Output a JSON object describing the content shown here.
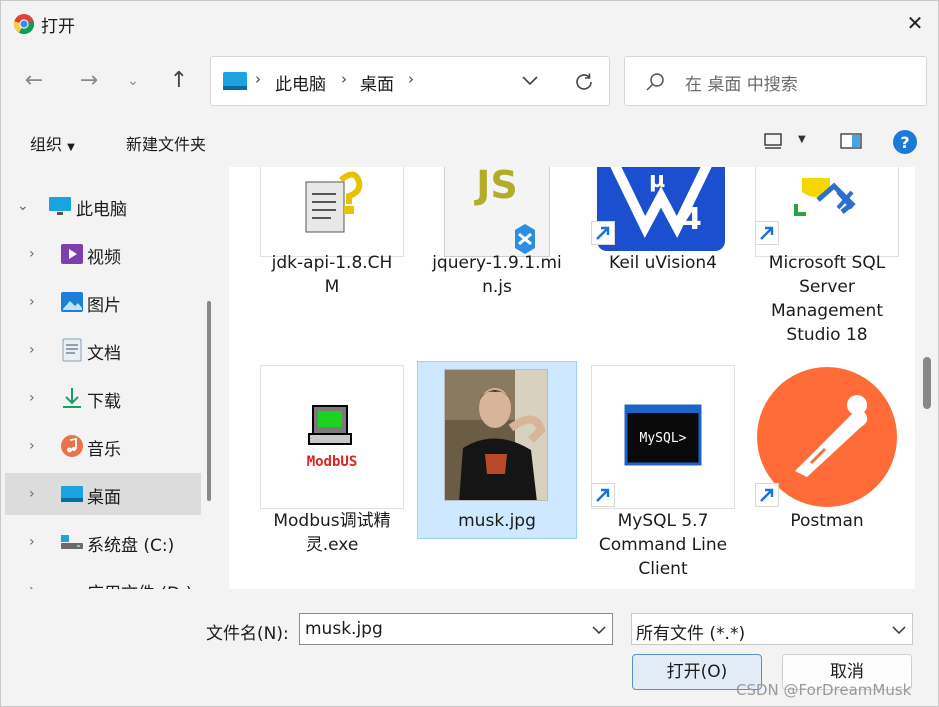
{
  "window": {
    "title": "打开"
  },
  "address": {
    "crumbs": [
      "此电脑",
      "桌面"
    ]
  },
  "search": {
    "placeholder": "在 桌面 中搜索"
  },
  "toolbar": {
    "organize": "组织",
    "new_folder": "新建文件夹"
  },
  "nav": {
    "items": [
      {
        "label": "此电脑",
        "icon": "monitor-icon"
      },
      {
        "label": "视频",
        "icon": "video-icon"
      },
      {
        "label": "图片",
        "icon": "pictures-icon"
      },
      {
        "label": "文档",
        "icon": "document-icon"
      },
      {
        "label": "下载",
        "icon": "download-icon"
      },
      {
        "label": "音乐",
        "icon": "music-icon"
      },
      {
        "label": "桌面",
        "icon": "desktop-icon"
      },
      {
        "label": "系统盘 (C:)",
        "icon": "drive-icon"
      },
      {
        "label": "应用文件 (D:)",
        "icon": "drive-icon"
      }
    ]
  },
  "files": [
    {
      "lines": [
        "jdk-api-1.8.CH",
        "M"
      ],
      "icon": "help-file-icon"
    },
    {
      "lines": [
        "jquery-1.9.1.mi",
        "n.js"
      ],
      "icon": "js-file-icon"
    },
    {
      "lines": [
        "Keil uVision4"
      ],
      "icon": "keil-icon",
      "shortcut": true
    },
    {
      "lines": [
        "Microsoft SQL",
        "Server",
        "Management",
        "Studio 18"
      ],
      "icon": "ssms-icon",
      "shortcut": true
    },
    {
      "lines": [
        "Modbus调试精",
        "灵.exe"
      ],
      "icon": "modbus-icon",
      "thumb_text": "ModbUS"
    },
    {
      "lines": [
        "musk.jpg"
      ],
      "icon": "photo-thumbnail",
      "selected": true
    },
    {
      "lines": [
        "MySQL 5.7",
        "Command Line",
        "Client"
      ],
      "icon": "mysql-icon",
      "shortcut": true,
      "thumb_text": "MySQL>"
    },
    {
      "lines": [
        "Postman"
      ],
      "icon": "postman-icon",
      "shortcut": true
    }
  ],
  "bottom": {
    "filename_label": "文件名(N):",
    "filename_value": "musk.jpg",
    "filetype_value": "所有文件 (*.*)",
    "open_label": "打开(O)",
    "cancel_label": "取消"
  },
  "watermark": "CSDN @ForDreamMusk",
  "colors": {
    "accent": "#0067c0",
    "selection": "#cde8ff",
    "postman": "#ff6c37"
  }
}
